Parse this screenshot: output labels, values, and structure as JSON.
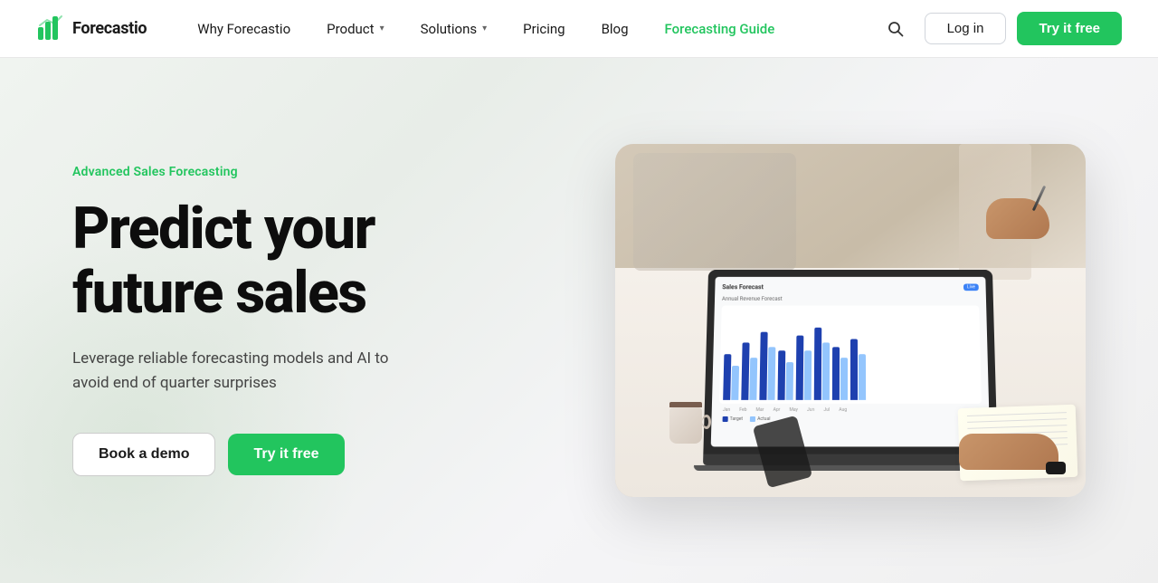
{
  "brand": {
    "name": "Forecastio",
    "logo_alt": "Forecastio logo"
  },
  "navbar": {
    "links": [
      {
        "id": "why",
        "label": "Why Forecastio",
        "hasDropdown": false
      },
      {
        "id": "product",
        "label": "Product",
        "hasDropdown": true
      },
      {
        "id": "solutions",
        "label": "Solutions",
        "hasDropdown": true
      },
      {
        "id": "pricing",
        "label": "Pricing",
        "hasDropdown": false
      },
      {
        "id": "blog",
        "label": "Blog",
        "hasDropdown": false
      },
      {
        "id": "guide",
        "label": "Forecasting Guide",
        "hasDropdown": false,
        "isGreen": true
      }
    ],
    "login_label": "Log in",
    "try_label": "Try it free"
  },
  "hero": {
    "tagline": "Advanced Sales Forecasting",
    "title_line1": "Predict your",
    "title_line2": "future sales",
    "subtitle": "Leverage reliable forecasting models and AI to avoid end of quarter surprises",
    "cta_demo": "Book a demo",
    "cta_try": "Try it free"
  },
  "chart": {
    "groups": [
      {
        "dark": 60,
        "light": 45
      },
      {
        "dark": 75,
        "light": 55
      },
      {
        "dark": 90,
        "light": 70
      },
      {
        "dark": 65,
        "light": 50
      },
      {
        "dark": 85,
        "light": 65
      },
      {
        "dark": 95,
        "light": 75
      },
      {
        "dark": 70,
        "light": 55
      },
      {
        "dark": 80,
        "light": 60
      }
    ],
    "labels": [
      "Jan",
      "Feb",
      "Mar",
      "Apr",
      "May",
      "Jun",
      "Jul",
      "Aug"
    ]
  },
  "colors": {
    "accent_green": "#22c55e",
    "brand_blue": "#3b82f6",
    "dark_blue": "#1e40af",
    "light_blue": "#93c5fd"
  }
}
